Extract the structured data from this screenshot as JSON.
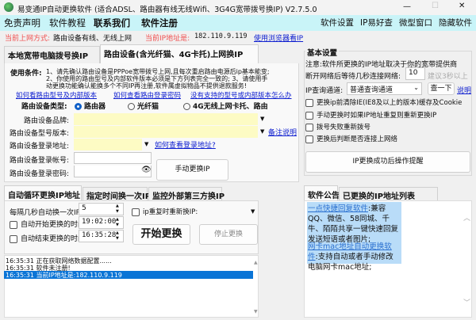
{
  "window": {
    "title": "易变通IP自动更换软件 (适合ADSL、路由器有线无线Wifi、3G4G宽带拨号换IP) V2.7.5.0",
    "minimize": "—",
    "maximize": "☐",
    "close": "✕"
  },
  "menu_left": [
    "免责声明",
    "软件教程",
    "联系我们",
    "软件注册"
  ],
  "menu_right": [
    "软件设置",
    "IP易好查",
    "微型窗口",
    "隐藏软件"
  ],
  "info": {
    "mode_label": "当前上网方式:",
    "mode_value": "路由设备有线、无线上网",
    "ip_label": "当前IP地址是:",
    "ip_value": "182.110.9.119",
    "browser_link": "使用浏览器看IP"
  },
  "top_tabs": [
    "本地宽带电脑拨号换IP",
    "路由设备(含光纤猫、4G卡托)上网换IP"
  ],
  "usage": {
    "label": "使用条件:",
    "line1": "1、请先确认路由设备是PPPoe宽带拨号上网,且每次重启路由电源后ip基本能变;",
    "line2": "2、你使用的路由型号及内部软件版本必须是下方列表完全一致的; 3、请使用手",
    "line3": "动更换功能确认能换多个不同IP再注册,软件属虚拟物品不提供退款服务!"
  },
  "links": [
    "如何看路由型号及内部版本",
    "如何查看路由登录密码",
    "没有支持的型号或内部版本怎么办"
  ],
  "router": {
    "type_label": "路由设备类型:",
    "types": [
      "路由器",
      "光纤猫",
      "4G无线上网卡托、路由"
    ],
    "brand_label": "路由设备品牌:",
    "model_label": "路由设备型号版本:",
    "model_link": "备注说明",
    "address_label": "路由设备登录地址:",
    "address_link": "如何查看登录地址?",
    "account_label": "路由设备登录帐号:",
    "password_label": "路由设备登录密码:",
    "manual_button": "手动更换IP"
  },
  "basic": {
    "title": "基本设置",
    "note": "注意:软件所更换的IP地址取决于你的宽带提供商",
    "wait_label": "断开网络后等待几秒连接网络:",
    "wait_value": "10",
    "wait_hint": "建议3秒以上",
    "channel_label": "IP查询通道:",
    "channel_value": "普通查询通道",
    "check_button": "查一下",
    "explain_link": "说明",
    "checks": [
      "更换ip前清除IE(IE8及以上的版本)缓存及Cookie",
      "手动更换时如果IP地址重复则重新更换IP",
      "拨号失败重新拨号",
      "更换后判断是否连接上网络"
    ],
    "remind_button": "IP更换成功后操作提醒"
  },
  "bottom_tabs": [
    "自动循环更换IP地址",
    "指定时间换一次IP",
    "监控外部第三方换IP"
  ],
  "auto": {
    "interval_label": "每隔几秒自动换一次IP:",
    "interval_value": "5",
    "start_label": "自动开始更换的时间:",
    "start_value": "19:02:00",
    "end_label": "自动结束更换的时间:",
    "end_value": "16:35:28",
    "repeat_label": "ip重复时重新换IP:",
    "start_button": "开始更换",
    "stop_button": "停止更换"
  },
  "log": [
    "16:35:31 正在获取网络数据配置......",
    "16:35:31 软件未注册!",
    "16:35:31 当前IP地址是:182.110.9.119"
  ],
  "right_tabs": [
    "软件公告",
    "已更换的IP地址列表"
  ],
  "notice": {
    "link1": "一点快捷回复软件",
    "text1": ":兼容QQ、微信、58同城、千牛、陌陌共享一键快速回复发送短语或者图片;",
    "link2": "网卡mac地址自动更换软件",
    "text2": ":支持自动或者手动修改电脑网卡mac地址;"
  }
}
